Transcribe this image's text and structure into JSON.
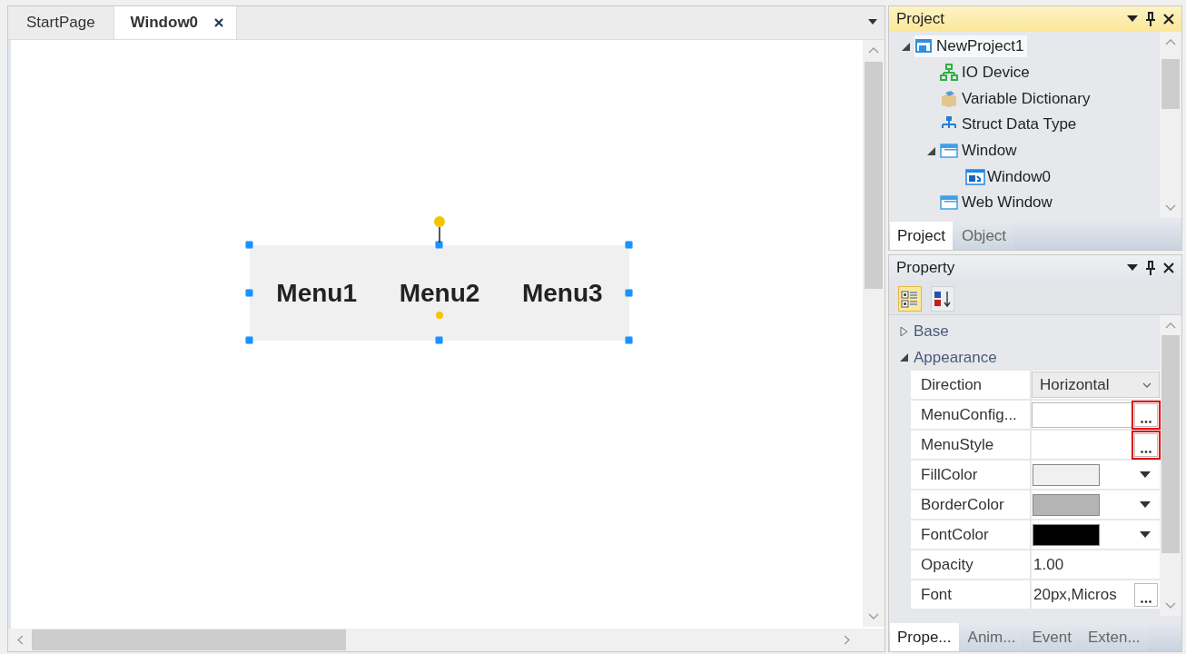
{
  "document_tabs": [
    {
      "label": "StartPage",
      "selected": false,
      "closable": false
    },
    {
      "label": "Window0",
      "selected": true,
      "closable": true
    }
  ],
  "canvas": {
    "menu_widget": {
      "selected": true,
      "items": [
        "Menu1",
        "Menu2",
        "Menu3"
      ]
    }
  },
  "project_panel": {
    "title": "Project",
    "tree": [
      {
        "label": "NewProject1",
        "kind": "project",
        "expanded": true,
        "selected": true,
        "children": [
          {
            "label": "IO Device",
            "kind": "device",
            "selected": false
          },
          {
            "label": "Variable Dictionary",
            "kind": "dictionary",
            "selected": false
          },
          {
            "label": "Struct Data Type",
            "kind": "struct",
            "selected": false
          },
          {
            "label": "Window",
            "kind": "folder",
            "expanded": true,
            "selected": false,
            "children": [
              {
                "label": "Window0",
                "kind": "window",
                "selected": false
              }
            ]
          },
          {
            "label": "Web Window",
            "kind": "folder",
            "selected": false
          }
        ]
      }
    ],
    "tabs": [
      {
        "label": "Project",
        "selected": true
      },
      {
        "label": "Object",
        "selected": false
      }
    ]
  },
  "property_panel": {
    "title": "Property",
    "toolbar": [
      {
        "kind": "categorized",
        "selected": true
      },
      {
        "kind": "alphabetical",
        "selected": false
      }
    ],
    "groups": [
      {
        "label": "Base",
        "expanded": false
      },
      {
        "label": "Appearance",
        "expanded": true,
        "properties": [
          {
            "name": "Direction",
            "kind": "dropdown",
            "value": "Horizontal"
          },
          {
            "name": "MenuConfig...",
            "kind": "ellipsis_field",
            "highlighted": true
          },
          {
            "name": "MenuStyle",
            "kind": "ellipsis",
            "highlighted": true
          },
          {
            "name": "FillColor",
            "kind": "color",
            "color": "#f0f0f0"
          },
          {
            "name": "BorderColor",
            "kind": "color",
            "color": "#b4b4b4"
          },
          {
            "name": "FontColor",
            "kind": "color",
            "color": "#000000"
          },
          {
            "name": "Opacity",
            "kind": "text",
            "value": "1.00"
          },
          {
            "name": "Font",
            "kind": "text_ellipsis",
            "value": "20px,Micros"
          }
        ]
      }
    ],
    "tabs": [
      {
        "label": "Prope...",
        "selected": true
      },
      {
        "label": "Anim...",
        "selected": false
      },
      {
        "label": "Event",
        "selected": false
      },
      {
        "label": "Exten...",
        "selected": false
      }
    ]
  }
}
